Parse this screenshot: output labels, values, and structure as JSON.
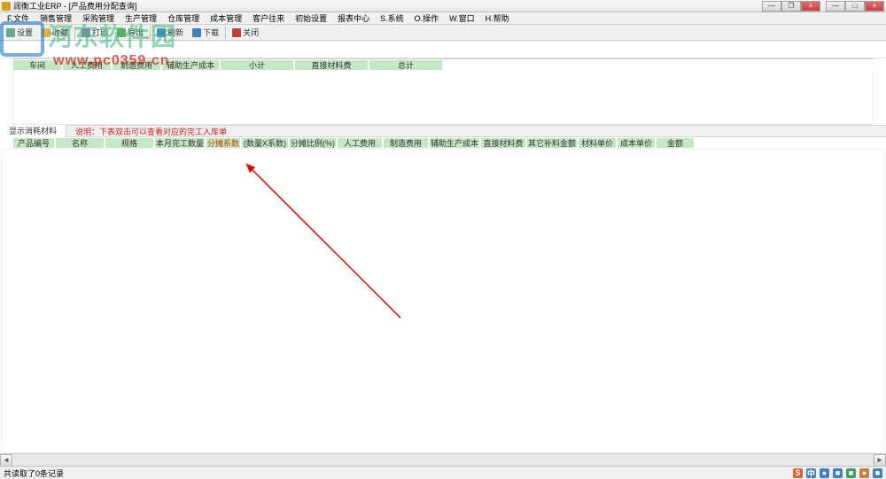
{
  "window": {
    "title": "润衡工业ERP - [产品费用分配查询]",
    "min": "—",
    "max": "□",
    "restore": "❐",
    "close": "×"
  },
  "menu": {
    "file": "F.文件",
    "sales": "销售管理",
    "purchase": "采购管理",
    "production": "生产管理",
    "warehouse": "仓库管理",
    "cost": "成本管理",
    "account": "客户往来",
    "init": "初始设置",
    "report": "报表中心",
    "system": "S.系统",
    "operate": "O.操作",
    "window": "W.窗口",
    "help": "H.帮助"
  },
  "toolbar": {
    "opt1": "设置",
    "opt2": "收藏",
    "opt3": "打印",
    "opt4": "导出",
    "opt5": "刷新",
    "opt6": "下载",
    "opt7": "关闭"
  },
  "watermark": {
    "text": "河东软件园",
    "url": "www.pc0359.cn"
  },
  "upper_grid": {
    "headers": [
      "车间",
      "人工费用",
      "制造费用",
      "辅助生产成本",
      "小计",
      "直接材料费",
      "总计"
    ]
  },
  "mid": {
    "tab": "显示消耗材料",
    "note": "说明：下表双击可以查看对应的完工入库单"
  },
  "lower_grid": {
    "headers": [
      "产品编号",
      "名称",
      "规格",
      "本月完工数量",
      "分摊系数",
      "(数量X系数)",
      "分摊比例(%)",
      "人工费用",
      "制造费用",
      "辅助生产成本",
      "直接材料费",
      "其它补料金额",
      "材料单价",
      "成本单价",
      "金额"
    ]
  },
  "status": {
    "text": "共读取了0条记录"
  },
  "tray": {
    "i1": "S",
    "i2": "中",
    "i3": "●",
    "i4": "■",
    "i5": "■",
    "i6": "●",
    "i7": "■"
  }
}
